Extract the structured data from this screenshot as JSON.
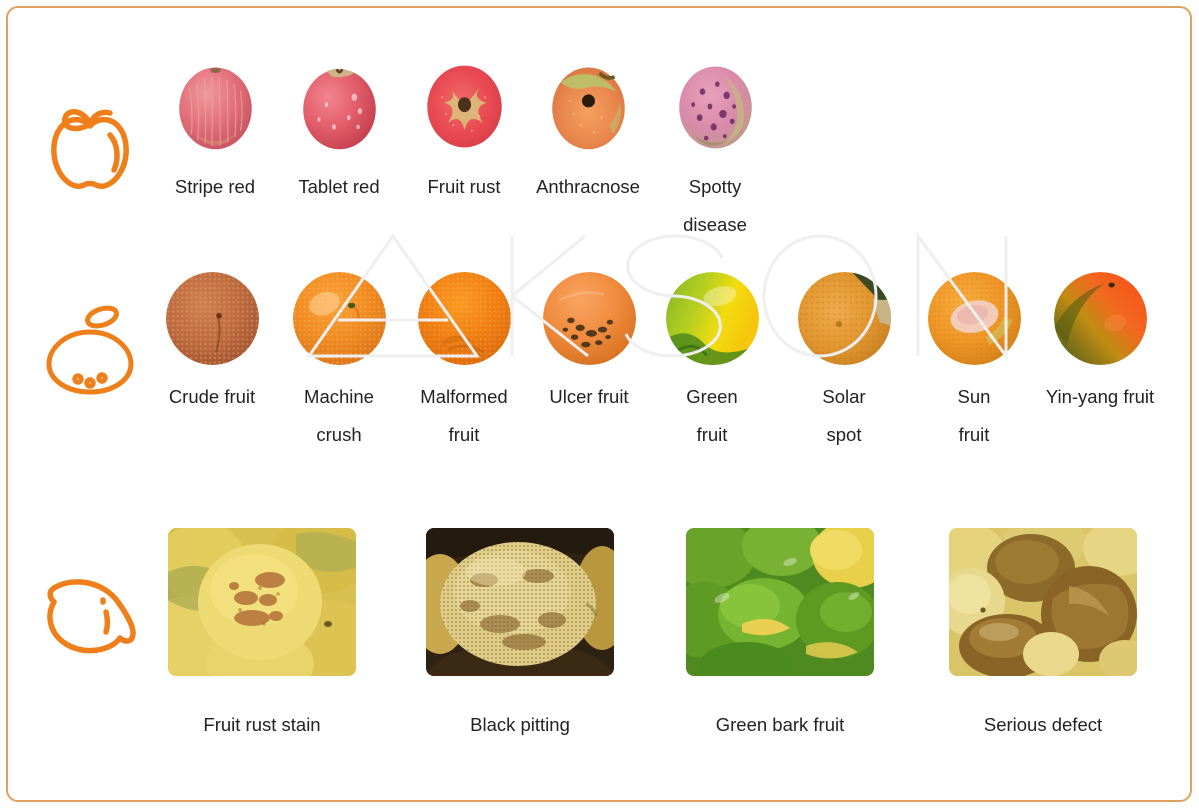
{
  "frame": {
    "border_color": "#e0a062",
    "background": "#ffffff"
  },
  "watermark": {
    "text": "AKSON",
    "color": "#f0f0f0"
  },
  "accent_color": "#ef7f1a",
  "rows": [
    {
      "id": "apple",
      "icon": "apple-icon",
      "items": [
        {
          "label": "Stripe red"
        },
        {
          "label": "Tablet red"
        },
        {
          "label": "Fruit rust"
        },
        {
          "label": "Anthracnose"
        },
        {
          "label": "Spotty disease"
        }
      ]
    },
    {
      "id": "orange",
      "icon": "orange-icon",
      "items": [
        {
          "label": "Crude fruit"
        },
        {
          "label": "Machine\ncrush"
        },
        {
          "label": "Malformed\nfruit"
        },
        {
          "label": "Ulcer fruit"
        },
        {
          "label": "Green\nfruit"
        },
        {
          "label": "Solar\nspot"
        },
        {
          "label": "Sun\nfruit"
        },
        {
          "label": "Yin-yang fruit"
        }
      ]
    },
    {
      "id": "lemon",
      "icon": "lemon-icon",
      "items": [
        {
          "label": "Fruit rust stain"
        },
        {
          "label": "Black pitting"
        },
        {
          "label": "Green bark fruit"
        },
        {
          "label": "Serious defect"
        }
      ]
    }
  ]
}
